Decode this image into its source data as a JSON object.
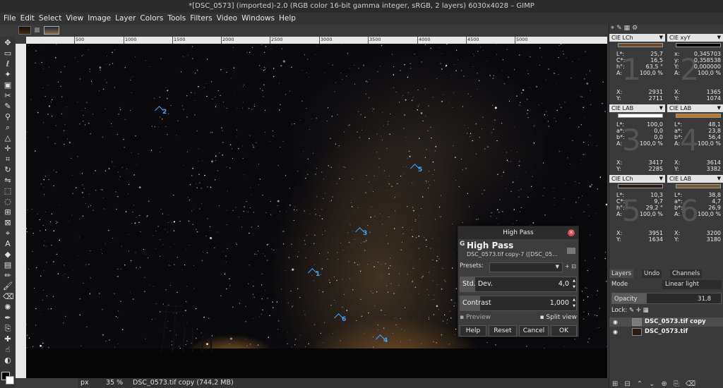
{
  "window": {
    "title": "*[DSC_0573] (imported)-2.0 (RGB color 16-bit gamma integer, sRGB, 2 layers) 6030x4028 – GIMP"
  },
  "menu": [
    "File",
    "Edit",
    "Select",
    "View",
    "Image",
    "Layer",
    "Colors",
    "Tools",
    "Filters",
    "Video",
    "Windows",
    "Help"
  ],
  "ruler": {
    "top_ticks": [
      "500",
      "1000",
      "1500",
      "2000",
      "2500",
      "3000",
      "3500",
      "4000",
      "4500",
      "5000"
    ],
    "left_ticks": [
      "1",
      "5",
      "0",
      "0",
      "5",
      "0",
      "0",
      "1",
      "0",
      "0",
      "0",
      "5",
      "0",
      "0"
    ]
  },
  "sample_points": [
    "1",
    "2",
    "3",
    "4",
    "5",
    "6"
  ],
  "status": {
    "unit": "px",
    "zoom": "35 %",
    "message": "DSC_0573.tif copy (744,2 MB)"
  },
  "pointer_panels": [
    {
      "mode": "CIE LCh",
      "swatch": "#6a4a2a",
      "num": "1",
      "rows": [
        [
          "L*:",
          "25,7"
        ],
        [
          "C*:",
          "16,5"
        ],
        [
          "h°:",
          "63,5 °"
        ],
        [
          "A:",
          "100,0 %"
        ]
      ],
      "xy": [
        [
          "X:",
          "2931"
        ],
        [
          "Y:",
          "2711"
        ]
      ]
    },
    {
      "mode": "CIE xyY",
      "swatch": "#000000",
      "num": "2",
      "rows": [
        [
          "x:",
          "0,345703"
        ],
        [
          "y:",
          "0,358538"
        ],
        [
          "Y:",
          "0,000000"
        ],
        [
          "A:",
          "100,0 %"
        ]
      ],
      "xy": [
        [
          "X:",
          "1365"
        ],
        [
          "Y:",
          "1074"
        ]
      ]
    },
    {
      "mode": "CIE LAB",
      "swatch": "#ffffff",
      "num": "3",
      "rows": [
        [
          "L*:",
          "100,0"
        ],
        [
          "a*:",
          "0,0"
        ],
        [
          "b*:",
          "0,0"
        ],
        [
          "A:",
          "100,0 %"
        ]
      ],
      "xy": [
        [
          "X:",
          "3417"
        ],
        [
          "Y:",
          "2285"
        ]
      ]
    },
    {
      "mode": "CIE LAB",
      "swatch": "#c07820",
      "num": "4",
      "rows": [
        [
          "L*:",
          "48,1"
        ],
        [
          "a*:",
          "23,8"
        ],
        [
          "b*:",
          "56,4"
        ],
        [
          "A:",
          "100,0 %"
        ]
      ],
      "xy": [
        [
          "X:",
          "3614"
        ],
        [
          "Y:",
          "3382"
        ]
      ]
    },
    {
      "mode": "CIE LCh",
      "swatch": "#2a1c18",
      "num": "5",
      "rows": [
        [
          "L*:",
          "10,3"
        ],
        [
          "C*:",
          "9,7"
        ],
        [
          "h°:",
          "29,2 °"
        ],
        [
          "A:",
          "100,0 %"
        ]
      ],
      "xy": [
        [
          "X:",
          "3951"
        ],
        [
          "Y:",
          "1634"
        ]
      ]
    },
    {
      "mode": "CIE LAB",
      "swatch": "#7a5a30",
      "num": "6",
      "rows": [
        [
          "L*:",
          "38,8"
        ],
        [
          "a*:",
          "4,7"
        ],
        [
          "b*:",
          "26,9"
        ],
        [
          "A:",
          "100,0 %"
        ]
      ],
      "xy": [
        [
          "X:",
          "3200"
        ],
        [
          "Y:",
          "3180"
        ]
      ]
    }
  ],
  "layers_panel": {
    "tabs": [
      "Layers",
      "Undo",
      "Channels"
    ],
    "mode_label": "Mode",
    "mode_value": "Linear light",
    "opacity_label": "Opacity",
    "opacity_value": "31,8",
    "opacity_percent": 31.8,
    "lock_label": "Lock:",
    "layers": [
      {
        "name": "DSC_0573.tif copy",
        "thumb": "#7a7a7a"
      },
      {
        "name": "DSC_0573.tif",
        "thumb": "#2a1c10"
      }
    ]
  },
  "dialog": {
    "title": "High Pass",
    "g_label": "G",
    "heading": "High Pass",
    "subtitle": "DSC_0573.tif copy-7 ([DSC_05...",
    "presets_label": "Presets:",
    "std_label": "Std. Dev.",
    "std_value": "4,0",
    "std_fraction": 0.13,
    "contrast_label": "Contrast",
    "contrast_value": "1,000",
    "contrast_fraction": 0.17,
    "preview_label": "Preview",
    "split_label": "Split view",
    "buttons": [
      "Help",
      "Reset",
      "Cancel",
      "OK"
    ]
  }
}
